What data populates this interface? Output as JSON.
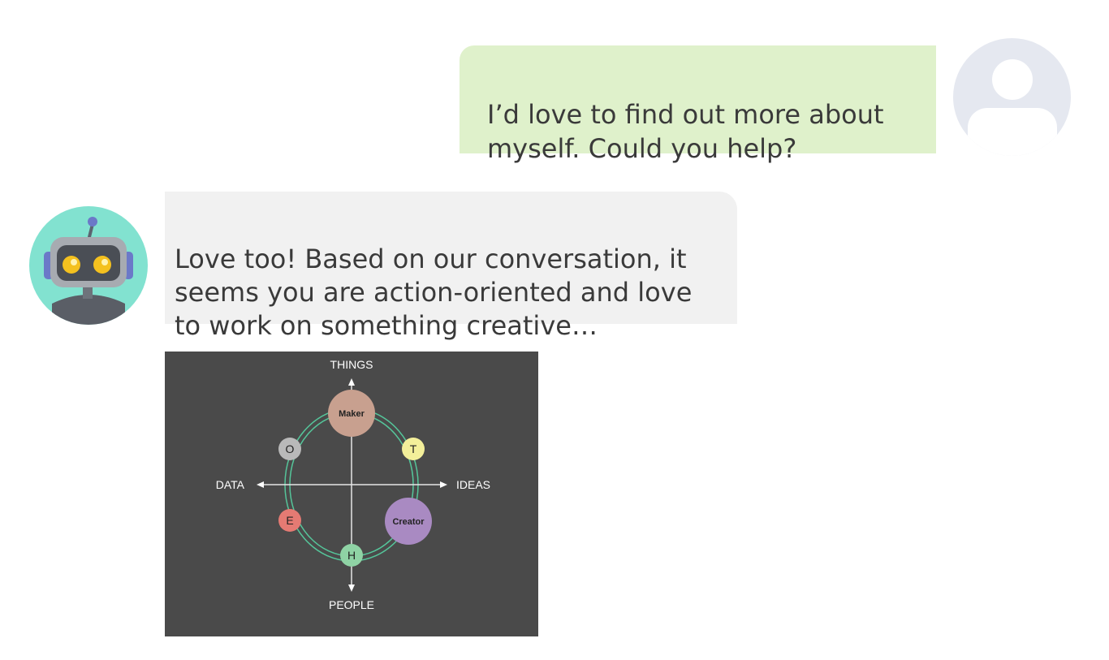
{
  "conversation": {
    "user_message": {
      "text": "I’d love to find out more about\nmyself. Could you help?",
      "bubble_color": "#dff1cb"
    },
    "bot_message": {
      "text": "Love too!  Based on our conversation, it\nseems you are action-oriented and love\nto work on something creative…",
      "bubble_color": "#f1f1f1"
    },
    "user_avatar_icon": "user-placeholder-icon",
    "bot_avatar_icon": "robot-icon"
  },
  "diagram": {
    "background": "#4a4a4a",
    "axes": {
      "top": "THINGS",
      "bottom": "PEOPLE",
      "left": "DATA",
      "right": "IDEAS"
    },
    "nodes": {
      "maker": {
        "label": "Maker",
        "color": "#c8a08f"
      },
      "creator": {
        "label": "Creator",
        "color": "#a98ac2"
      },
      "o": {
        "label": "O",
        "color": "#b9b9b9"
      },
      "t": {
        "label": "T",
        "color": "#f3ef9a"
      },
      "e": {
        "label": "E",
        "color": "#e57a73"
      },
      "h": {
        "label": "H",
        "color": "#8fd3a5"
      }
    },
    "ring_color": "#55c59a"
  }
}
